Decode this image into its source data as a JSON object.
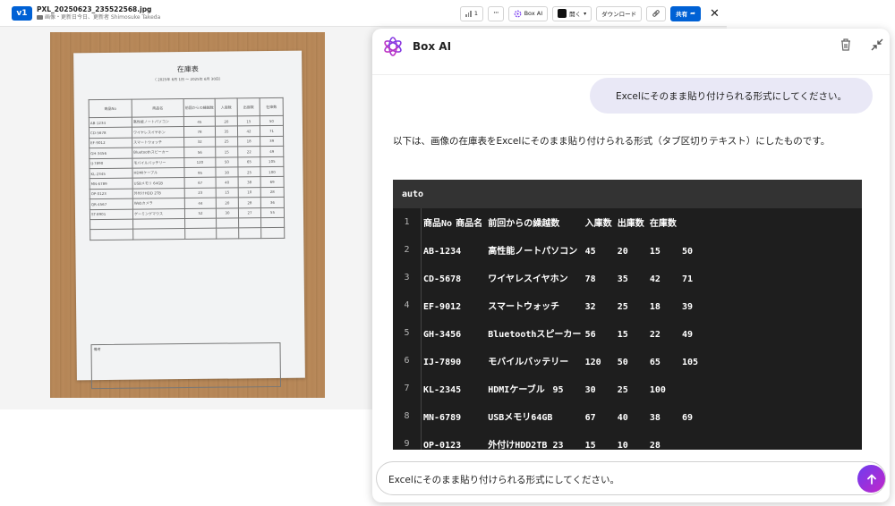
{
  "header": {
    "version_badge": "v1",
    "file_name": "PXL_20250623_235522568.jpg",
    "file_meta": "画像・更新日今日、更新者 Shimosuke Takeda",
    "view_count": "1",
    "more_label": "···",
    "box_ai_label": "Box AI",
    "open_label": "開く",
    "download_label": "ダウンロード",
    "share_label": "共有",
    "close_label": "✕"
  },
  "photo": {
    "title": "在庫表",
    "period": "（ 2025年 6月 1日 〜 2025年 6月 30日）",
    "columns": [
      "商品No",
      "商品名",
      "前回からの繰越数",
      "入庫数",
      "出庫数",
      "在庫数"
    ],
    "rows": [
      [
        "AB-1234",
        "高性能ノートパソコン",
        "45",
        "20",
        "15",
        "50"
      ],
      [
        "CD-5678",
        "ワイヤレスイヤホン",
        "78",
        "35",
        "42",
        "71"
      ],
      [
        "EF-9012",
        "スマートウォッチ",
        "32",
        "25",
        "18",
        "39"
      ],
      [
        "GH-3456",
        "Bluetoothスピーカー",
        "56",
        "15",
        "22",
        "49"
      ],
      [
        "IJ-7890",
        "モバイルバッテリー",
        "120",
        "50",
        "65",
        "105"
      ],
      [
        "KL-2345",
        "HDMIケーブル",
        "95",
        "30",
        "25",
        "100"
      ],
      [
        "MN-6789",
        "USBメモリ 64GB",
        "67",
        "40",
        "38",
        "69"
      ],
      [
        "OP-0123",
        "外付けHDD 2TB",
        "23",
        "15",
        "10",
        "28"
      ],
      [
        "QR-4567",
        "Webカメラ",
        "44",
        "20",
        "28",
        "36"
      ],
      [
        "ST-8901",
        "ゲーミングマウス",
        "52",
        "30",
        "27",
        "55"
      ],
      [
        "",
        "",
        "",
        "",
        "",
        ""
      ],
      [
        "",
        "",
        "",
        "",
        "",
        ""
      ]
    ],
    "notes_label": "備考"
  },
  "ai": {
    "title": "Box AI",
    "user_message": "Excelにそのまま貼り付けられる形式にしてください。",
    "response_intro": "以下は、画像の在庫表をExcelにそのまま貼り付けられる形式（タブ区切りテキスト）にしたものです。",
    "code_language": "auto",
    "code_lines": [
      {
        "num": "1",
        "text": "商品No\t商品名\t前回からの繰越数\t入庫数\t出庫数\t在庫数"
      },
      {
        "num": "2",
        "text": "AB-1234\t高性能ノートパソコン\t45\t20\t15\t50"
      },
      {
        "num": "3",
        "text": "CD-5678\tワイヤレスイヤホン\t78\t35\t42\t71"
      },
      {
        "num": "4",
        "text": "EF-9012\tスマートウォッチ\t32\t25\t18\t39"
      },
      {
        "num": "5",
        "text": "GH-3456\tBluetoothスピーカー\t56\t15\t22\t49"
      },
      {
        "num": "6",
        "text": "IJ-7890\tモバイルバッテリー\t120\t50\t65\t105"
      },
      {
        "num": "7",
        "text": "KL-2345\tHDMIケーブル\t95\t30\t25\t100"
      },
      {
        "num": "8",
        "text": "MN-6789\tUSBメモリ64GB\t67\t40\t38\t69"
      },
      {
        "num": "9",
        "text": "OP-0123\t外付けHDD2TB\t23\t15\t10\t28"
      }
    ],
    "input_value": "Excelにそのまま貼り付けられる形式にしてください。"
  },
  "colors": {
    "accent": "#0061d5",
    "send_gradient_start": "#6d3df0",
    "send_gradient_end": "#c326c9",
    "bubble": "#e9e8f6",
    "code_bg": "#1e1e1e"
  },
  "icons": [
    "folder-icon",
    "views-icon",
    "more-icon",
    "box-ai-icon",
    "open-app-icon",
    "link-icon",
    "share-arrow-icon",
    "close-icon",
    "box-ai-logo-icon",
    "trash-icon",
    "collapse-icon",
    "send-arrow-icon"
  ]
}
